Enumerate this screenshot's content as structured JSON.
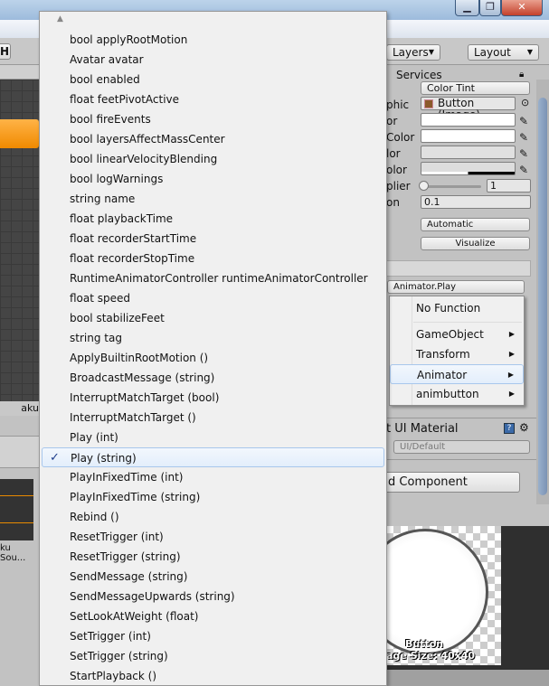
{
  "window": {
    "minimize_icon": "minimize-icon",
    "restore_icon": "restore-icon",
    "close_icon": "close-icon"
  },
  "toolbar": {
    "layers_label": "Layers",
    "layout_label": "Layout",
    "left_button": "H"
  },
  "inspector": {
    "services_tab": "Services",
    "transition": "Color Tint",
    "target_graphic_label": "phic",
    "target_graphic_value": "Button (Image)",
    "labels": [
      "or",
      "Color",
      "lor",
      "olor",
      "plier",
      "on"
    ],
    "multiplier_value": "1",
    "fade_value": "0.1",
    "navigation": "Automatic",
    "visualize": "Visualize",
    "function_value": "Animator.Play",
    "material_label": "t UI Material",
    "material_value": "UI/Default",
    "add_component": "d Component"
  },
  "left_panel": {
    "graph_label": "aku",
    "asset_label": "ku Sou..."
  },
  "preview": {
    "name": "Button",
    "size": "age Size: 40x40"
  },
  "submenu": {
    "items": [
      {
        "label": "No Function",
        "arrow": false
      },
      {
        "label": "GameObject",
        "arrow": true
      },
      {
        "label": "Transform",
        "arrow": true
      },
      {
        "label": "Animator",
        "arrow": true,
        "highlighted": true
      },
      {
        "label": "animbutton",
        "arrow": true
      }
    ]
  },
  "menu": {
    "selected_index": 21,
    "items": [
      "bool applyRootMotion",
      "Avatar avatar",
      "bool enabled",
      "float feetPivotActive",
      "bool fireEvents",
      "bool layersAffectMassCenter",
      "bool linearVelocityBlending",
      "bool logWarnings",
      "string name",
      "float playbackTime",
      "float recorderStartTime",
      "float recorderStopTime",
      "RuntimeAnimatorController runtimeAnimatorController",
      "float speed",
      "bool stabilizeFeet",
      "string tag",
      "ApplyBuiltinRootMotion ()",
      "BroadcastMessage (string)",
      "InterruptMatchTarget (bool)",
      "InterruptMatchTarget ()",
      "Play (int)",
      "Play (string)",
      "PlayInFixedTime (int)",
      "PlayInFixedTime (string)",
      "Rebind ()",
      "ResetTrigger (int)",
      "ResetTrigger (string)",
      "SendMessage (string)",
      "SendMessageUpwards (string)",
      "SetLookAtWeight (float)",
      "SetTrigger (int)",
      "SetTrigger (string)",
      "StartPlayback ()"
    ]
  }
}
